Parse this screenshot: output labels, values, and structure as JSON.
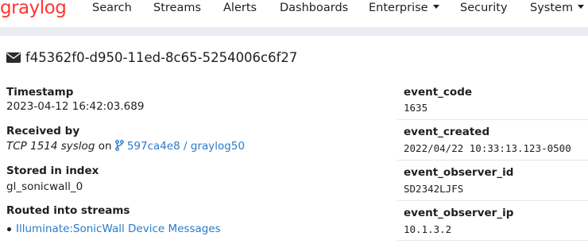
{
  "nav": {
    "logo_text": "graylog",
    "items": [
      {
        "label": "Search"
      },
      {
        "label": "Streams"
      },
      {
        "label": "Alerts"
      },
      {
        "label": "Dashboards"
      },
      {
        "label": "Enterprise"
      },
      {
        "label": "Security"
      },
      {
        "label": "System"
      }
    ]
  },
  "message": {
    "id": "f45362f0-d950-11ed-8c65-5254006c6f27",
    "timestamp_label": "Timestamp",
    "timestamp_value": "2023-04-12 16:42:03.689",
    "received_label": "Received by",
    "received_input": "TCP 1514 syslog",
    "received_on": "on",
    "received_node": "597ca4e8 / graylog50",
    "stored_label": "Stored in index",
    "stored_value": "gl_sonicwall_0",
    "routed_label": "Routed into streams",
    "streams": [
      "Illuminate:SonicWall Device Messages"
    ]
  },
  "fields": [
    {
      "name": "event_code",
      "value": "1635"
    },
    {
      "name": "event_created",
      "value": "2022/04/22 10:33:13.123-0500"
    },
    {
      "name": "event_observer_id",
      "value": "SD2342LJFS"
    },
    {
      "name": "event_observer_ip",
      "value": "10.1.3.2"
    }
  ],
  "colors": {
    "brand": "#ff3633",
    "link": "#2c7ac7",
    "band": "#e9ecf1"
  },
  "icons": {
    "envelope": "envelope-icon",
    "branch": "code-branch-icon"
  }
}
